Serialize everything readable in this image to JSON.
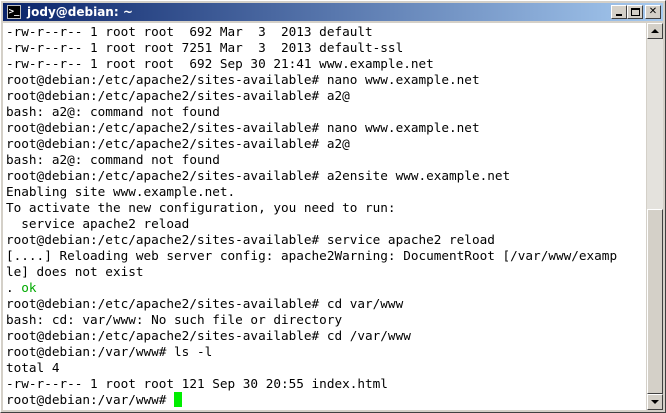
{
  "window": {
    "title": "jody@debian: ~",
    "icon": "terminal-icon",
    "controls": {
      "minimize": "minimize-icon",
      "maximize": "maximize-icon",
      "close_label": "✕"
    }
  },
  "terminal": {
    "lines": [
      "-rw-r--r-- 1 root root  692 Mar  3  2013 default",
      "-rw-r--r-- 1 root root 7251 Mar  3  2013 default-ssl",
      "-rw-r--r-- 1 root root  692 Sep 30 21:41 www.example.net",
      "root@debian:/etc/apache2/sites-available# nano www.example.net",
      "root@debian:/etc/apache2/sites-available# a2@",
      "bash: a2@: command not found",
      "root@debian:/etc/apache2/sites-available# nano www.example.net",
      "root@debian:/etc/apache2/sites-available# a2@",
      "bash: a2@: command not found",
      "root@debian:/etc/apache2/sites-available# a2ensite www.example.net",
      "Enabling site www.example.net.",
      "To activate the new configuration, you need to run:",
      "  service apache2 reload",
      "root@debian:/etc/apache2/sites-available# service apache2 reload",
      "[....] Reloading web server config: apache2Warning: DocumentRoot [/var/www/examp",
      "le] does not exist",
      "root@debian:/etc/apache2/sites-available# cd var/www",
      "bash: cd: var/www: No such file or directory",
      "root@debian:/etc/apache2/sites-available# cd /var/www",
      "root@debian:/var/www# ls -l",
      "total 4",
      "-rw-r--r-- 1 root root 121 Sep 30 20:55 index.html"
    ],
    "ok_prefix": ". ",
    "ok_text": "ok",
    "prompt": "root@debian:/var/www# ",
    "colors": {
      "background": "#ffffff",
      "foreground": "#000000",
      "ok": "#00aa00",
      "cursor": "#00ee00"
    }
  },
  "scrollbar": {
    "position_fraction": 1.0
  }
}
